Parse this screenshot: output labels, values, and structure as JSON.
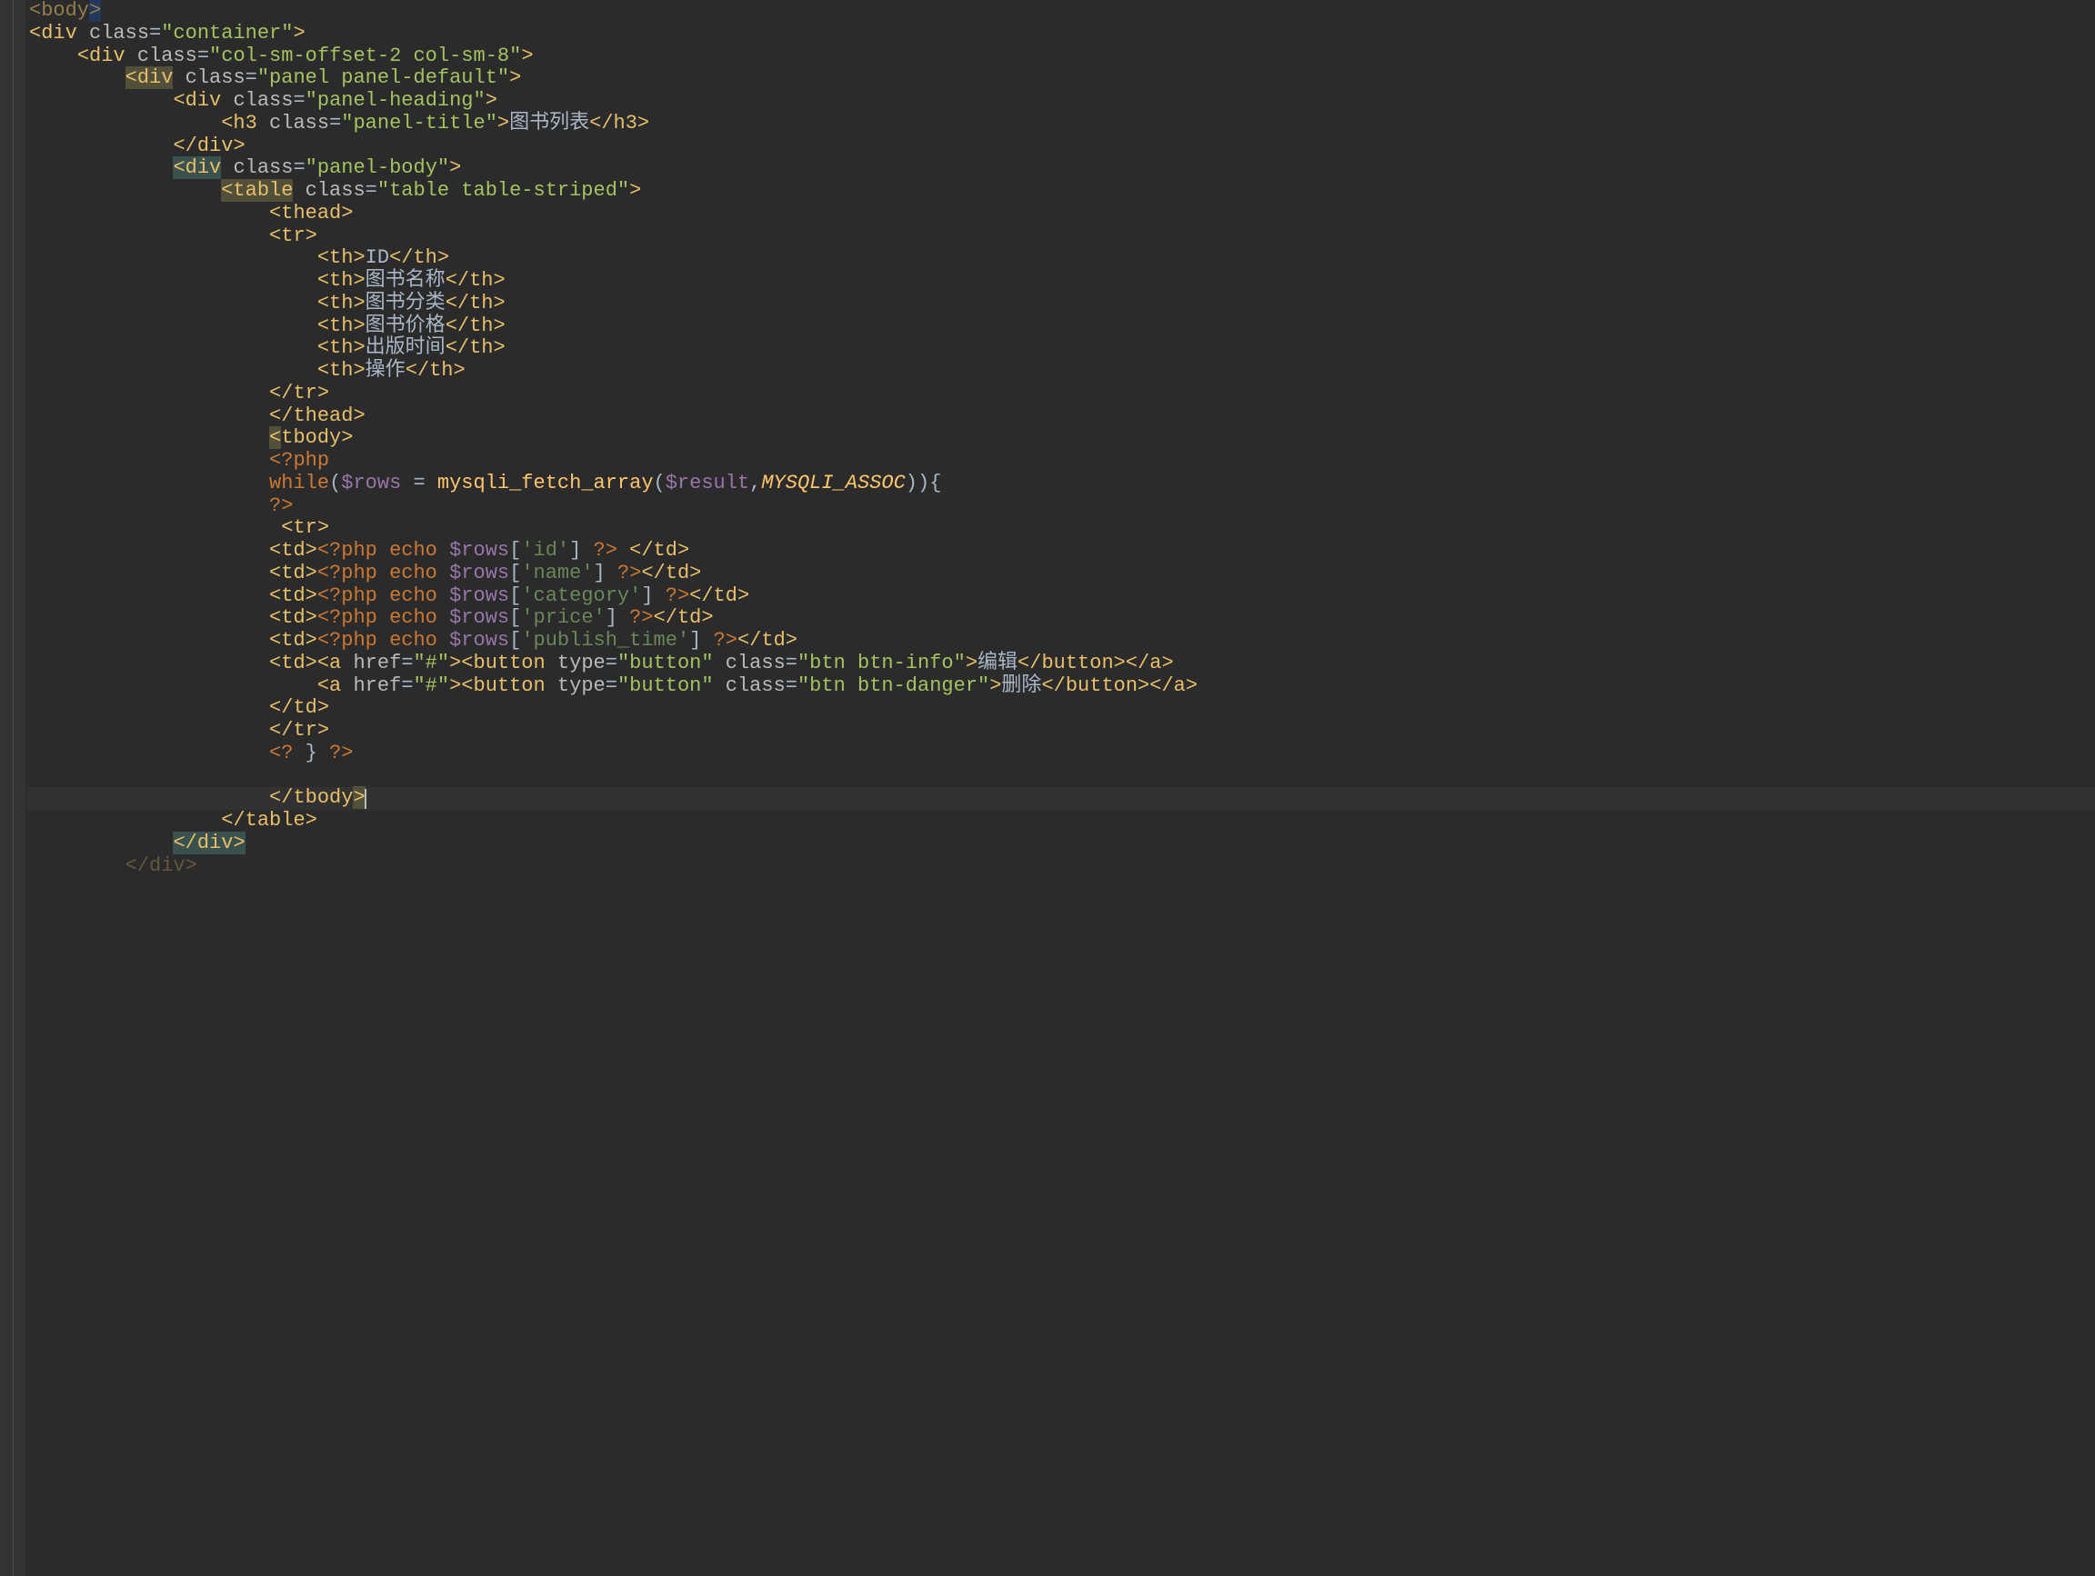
{
  "editor": {
    "theme": "darcula",
    "lang": "php-html",
    "highlighted_line_index": 35,
    "lines": [
      {
        "indent": 0,
        "tokens": [
          {
            "t": "tag",
            "v": "<body"
          },
          {
            "t": "sel-end",
            "v": ">"
          }
        ],
        "dim": true
      },
      {
        "indent": 0,
        "tokens": [
          {
            "t": "tag",
            "v": "<div "
          },
          {
            "t": "attr",
            "v": "class"
          },
          {
            "t": "eq",
            "v": "="
          },
          {
            "t": "str",
            "v": "\"container\""
          },
          {
            "t": "tag",
            "v": ">"
          }
        ]
      },
      {
        "indent": 1,
        "tokens": [
          {
            "t": "tag",
            "v": "<div "
          },
          {
            "t": "attr",
            "v": "class"
          },
          {
            "t": "eq",
            "v": "="
          },
          {
            "t": "str",
            "v": "\"col-sm-offset-2 col-sm-8\""
          },
          {
            "t": "tag",
            "v": ">"
          }
        ]
      },
      {
        "indent": 2,
        "tokens": [
          {
            "t": "tagbg",
            "v": "<div"
          },
          {
            "t": "tag",
            "v": " "
          },
          {
            "t": "attr",
            "v": "class"
          },
          {
            "t": "eq",
            "v": "="
          },
          {
            "t": "str",
            "v": "\"panel panel-default\""
          },
          {
            "t": "tag",
            "v": ">"
          }
        ]
      },
      {
        "indent": 3,
        "tokens": [
          {
            "t": "tag",
            "v": "<div "
          },
          {
            "t": "attr",
            "v": "class"
          },
          {
            "t": "eq",
            "v": "="
          },
          {
            "t": "str",
            "v": "\"panel-heading\""
          },
          {
            "t": "tag",
            "v": ">"
          }
        ]
      },
      {
        "indent": 4,
        "tokens": [
          {
            "t": "tag",
            "v": "<h3 "
          },
          {
            "t": "attr",
            "v": "class"
          },
          {
            "t": "eq",
            "v": "="
          },
          {
            "t": "str",
            "v": "\"panel-title\""
          },
          {
            "t": "tag",
            "v": ">"
          },
          {
            "t": "text",
            "v": "图书列表"
          },
          {
            "t": "tag",
            "v": "</h3>"
          }
        ]
      },
      {
        "indent": 3,
        "tokens": [
          {
            "t": "tag",
            "v": "</div>"
          }
        ]
      },
      {
        "indent": 3,
        "tokens": [
          {
            "t": "tagbg2",
            "v": "<div"
          },
          {
            "t": "tag",
            "v": " "
          },
          {
            "t": "attr",
            "v": "class"
          },
          {
            "t": "eq",
            "v": "="
          },
          {
            "t": "str",
            "v": "\"panel-body\""
          },
          {
            "t": "tag",
            "v": ">"
          }
        ]
      },
      {
        "indent": 4,
        "tokens": [
          {
            "t": "tagbg",
            "v": "<table"
          },
          {
            "t": "tag",
            "v": " "
          },
          {
            "t": "attr",
            "v": "class"
          },
          {
            "t": "eq",
            "v": "="
          },
          {
            "t": "str",
            "v": "\"table table-striped\""
          },
          {
            "t": "tag",
            "v": ">"
          }
        ]
      },
      {
        "indent": 5,
        "tokens": [
          {
            "t": "tag",
            "v": "<thead>"
          }
        ]
      },
      {
        "indent": 5,
        "tokens": [
          {
            "t": "tag",
            "v": "<tr>"
          }
        ]
      },
      {
        "indent": 6,
        "tokens": [
          {
            "t": "tag",
            "v": "<th>"
          },
          {
            "t": "text",
            "v": "ID"
          },
          {
            "t": "tag",
            "v": "</th>"
          }
        ]
      },
      {
        "indent": 6,
        "tokens": [
          {
            "t": "tag",
            "v": "<th>"
          },
          {
            "t": "text",
            "v": "图书名称"
          },
          {
            "t": "tag",
            "v": "</th>"
          }
        ]
      },
      {
        "indent": 6,
        "tokens": [
          {
            "t": "tag",
            "v": "<th>"
          },
          {
            "t": "text",
            "v": "图书分类"
          },
          {
            "t": "tag",
            "v": "</th>"
          }
        ]
      },
      {
        "indent": 6,
        "tokens": [
          {
            "t": "tag",
            "v": "<th>"
          },
          {
            "t": "text",
            "v": "图书价格"
          },
          {
            "t": "tag",
            "v": "</th>"
          }
        ]
      },
      {
        "indent": 6,
        "tokens": [
          {
            "t": "tag",
            "v": "<th>"
          },
          {
            "t": "text",
            "v": "出版时间"
          },
          {
            "t": "tag",
            "v": "</th>"
          }
        ]
      },
      {
        "indent": 6,
        "tokens": [
          {
            "t": "tag",
            "v": "<th>"
          },
          {
            "t": "text",
            "v": "操作"
          },
          {
            "t": "tag",
            "v": "</th>"
          }
        ]
      },
      {
        "indent": 5,
        "tokens": [
          {
            "t": "tag",
            "v": "</tr>"
          }
        ]
      },
      {
        "indent": 5,
        "tokens": [
          {
            "t": "tag",
            "v": "</thead>"
          }
        ]
      },
      {
        "indent": 5,
        "tokens": [
          {
            "t": "tagbg",
            "v": "<"
          },
          {
            "t": "tag",
            "v": "tbody>"
          }
        ]
      },
      {
        "indent": 5,
        "tokens": [
          {
            "t": "php",
            "v": "<?php"
          }
        ]
      },
      {
        "indent": 5,
        "tokens": [
          {
            "t": "phpcode",
            "v": "while($rows = mysqli_fetch_array($result,MYSQLI_ASSOC)){"
          }
        ]
      },
      {
        "indent": 5,
        "tokens": [
          {
            "t": "php",
            "v": "?>"
          }
        ]
      },
      {
        "indent": 5,
        "tokens": [
          {
            "t": "text",
            "v": " "
          },
          {
            "t": "tag",
            "v": "<tr>"
          }
        ]
      },
      {
        "indent": 5,
        "tokens": [
          {
            "t": "tag",
            "v": "<td>"
          },
          {
            "t": "php",
            "v": "<?php "
          },
          {
            "t": "phpecho",
            "v": "echo $rows['id'] "
          },
          {
            "t": "php",
            "v": "?>"
          },
          {
            "t": "text",
            "v": " "
          },
          {
            "t": "tag",
            "v": "</td>"
          }
        ]
      },
      {
        "indent": 5,
        "tokens": [
          {
            "t": "tag",
            "v": "<td>"
          },
          {
            "t": "php",
            "v": "<?php "
          },
          {
            "t": "phpecho",
            "v": "echo $rows['name'] "
          },
          {
            "t": "php",
            "v": "?>"
          },
          {
            "t": "tag",
            "v": "</td>"
          }
        ]
      },
      {
        "indent": 5,
        "tokens": [
          {
            "t": "tag",
            "v": "<td>"
          },
          {
            "t": "php",
            "v": "<?php "
          },
          {
            "t": "phpecho",
            "v": "echo $rows['category'] "
          },
          {
            "t": "php",
            "v": "?>"
          },
          {
            "t": "tag",
            "v": "</td>"
          }
        ]
      },
      {
        "indent": 5,
        "tokens": [
          {
            "t": "tag",
            "v": "<td>"
          },
          {
            "t": "php",
            "v": "<?php "
          },
          {
            "t": "phpecho",
            "v": "echo $rows['price'] "
          },
          {
            "t": "php",
            "v": "?>"
          },
          {
            "t": "tag",
            "v": "</td>"
          }
        ]
      },
      {
        "indent": 5,
        "tokens": [
          {
            "t": "tag",
            "v": "<td>"
          },
          {
            "t": "php",
            "v": "<?php "
          },
          {
            "t": "phpecho",
            "v": "echo $rows['publish_time'] "
          },
          {
            "t": "php",
            "v": "?>"
          },
          {
            "t": "tag",
            "v": "</td>"
          }
        ]
      },
      {
        "indent": 5,
        "tokens": [
          {
            "t": "tag",
            "v": "<td><a "
          },
          {
            "t": "attr",
            "v": "href"
          },
          {
            "t": "eq",
            "v": "="
          },
          {
            "t": "str",
            "v": "\"#\""
          },
          {
            "t": "tag",
            "v": "><button "
          },
          {
            "t": "attr",
            "v": "type"
          },
          {
            "t": "eq",
            "v": "="
          },
          {
            "t": "str",
            "v": "\"button\""
          },
          {
            "t": "tag",
            "v": " "
          },
          {
            "t": "attr",
            "v": "class"
          },
          {
            "t": "eq",
            "v": "="
          },
          {
            "t": "str",
            "v": "\"btn btn-info\""
          },
          {
            "t": "tag",
            "v": ">"
          },
          {
            "t": "text",
            "v": "编辑"
          },
          {
            "t": "tag",
            "v": "</button></a>"
          }
        ]
      },
      {
        "indent": 6,
        "tokens": [
          {
            "t": "tag",
            "v": "<a "
          },
          {
            "t": "attr",
            "v": "href"
          },
          {
            "t": "eq",
            "v": "="
          },
          {
            "t": "str",
            "v": "\"#\""
          },
          {
            "t": "tag",
            "v": "><button "
          },
          {
            "t": "attr",
            "v": "type"
          },
          {
            "t": "eq",
            "v": "="
          },
          {
            "t": "str",
            "v": "\"button\""
          },
          {
            "t": "tag",
            "v": " "
          },
          {
            "t": "attr",
            "v": "class"
          },
          {
            "t": "eq",
            "v": "="
          },
          {
            "t": "str",
            "v": "\"btn btn-danger\""
          },
          {
            "t": "tag",
            "v": ">"
          },
          {
            "t": "text",
            "v": "删除"
          },
          {
            "t": "tag",
            "v": "</button></a>"
          }
        ]
      },
      {
        "indent": 5,
        "tokens": [
          {
            "t": "tag",
            "v": "</td>"
          }
        ]
      },
      {
        "indent": 5,
        "tokens": [
          {
            "t": "tag",
            "v": "</tr>"
          }
        ]
      },
      {
        "indent": 5,
        "tokens": [
          {
            "t": "php",
            "v": "<? "
          },
          {
            "t": "phppunc",
            "v": "} "
          },
          {
            "t": "php",
            "v": "?>"
          }
        ]
      },
      {
        "indent": 5,
        "tokens": []
      },
      {
        "indent": 5,
        "tokens": [
          {
            "t": "tag",
            "v": "</tbody"
          },
          {
            "t": "tagbg",
            "v": ">"
          }
        ],
        "hl": true,
        "caret": true
      },
      {
        "indent": 4,
        "tokens": [
          {
            "t": "tag",
            "v": "</table>"
          }
        ]
      },
      {
        "indent": 3,
        "tokens": [
          {
            "t": "tagbg2",
            "v": "</div>"
          }
        ]
      },
      {
        "indent": 2,
        "tokens": [
          {
            "t": "tag-dim",
            "v": "</div>"
          }
        ],
        "dim": true
      }
    ]
  }
}
